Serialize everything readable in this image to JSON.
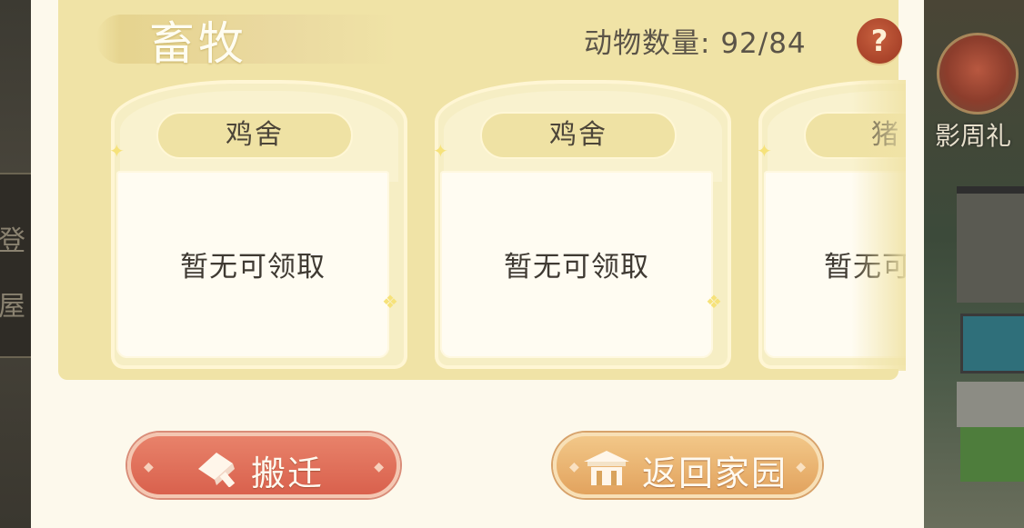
{
  "background": {
    "left_chars": [
      "登",
      "屋"
    ],
    "right_label": "影周礼"
  },
  "panel": {
    "title": "畜牧",
    "animal_count_label": "动物数量:",
    "animal_count_value": "92/84",
    "help_symbol": "?"
  },
  "cards": [
    {
      "name": "鸡舍",
      "status": "暂无可领取"
    },
    {
      "name": "鸡舍",
      "status": "暂无可领取"
    },
    {
      "name": "猪",
      "status": "暂无可"
    }
  ],
  "buttons": {
    "relocate": "搬迁",
    "return_home": "返回家园"
  },
  "colors": {
    "panel_bg": "#fdf9ec",
    "section_bg": "#f0e3a6",
    "relocate_btn": "#d9614d",
    "home_btn": "#e2a35e",
    "help_btn": "#a9432a"
  }
}
